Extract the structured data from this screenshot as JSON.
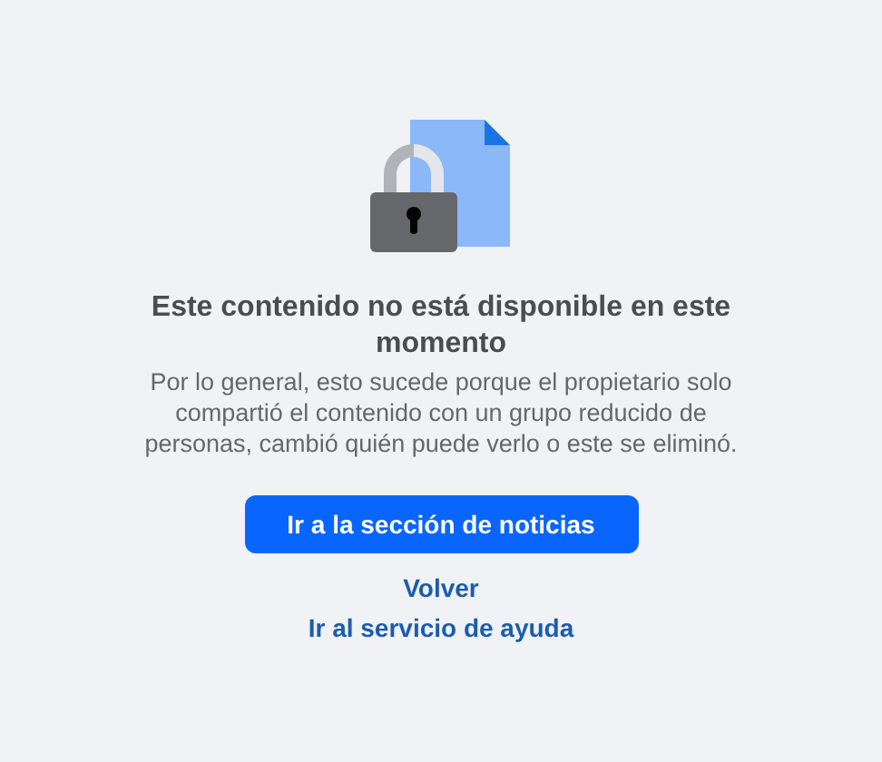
{
  "title": "Este contenido no está disponible en este momento",
  "message": "Por lo general, esto sucede porque el propietario solo compartió el contenido con un grupo reducido de personas, cambió quién puede verlo o este se eliminó.",
  "primary_button": "Ir a la sección de noticias",
  "links": [
    "Volver",
    "Ir al servicio de ayuda"
  ]
}
